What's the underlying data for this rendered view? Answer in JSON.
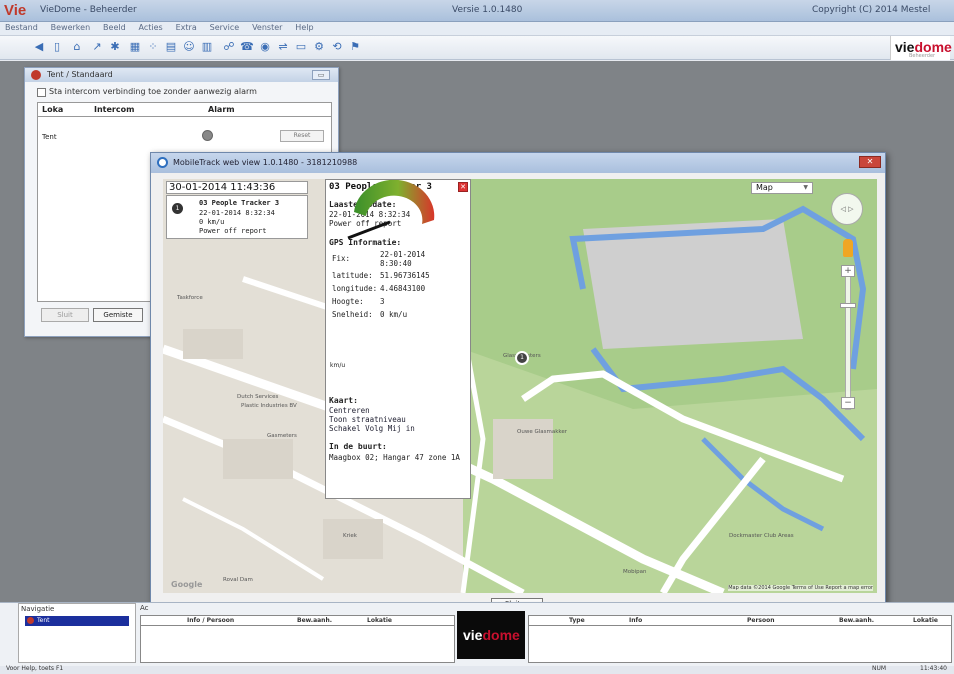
{
  "app": {
    "logo": "Vie",
    "title": "VieDome - Beheerder",
    "version": "Versie 1.0.1480",
    "copyright": "Copyright (C) 2014 Mestel"
  },
  "menu": [
    "Bestand",
    "Bewerken",
    "Beeld",
    "Acties",
    "Extra",
    "Service",
    "Venster",
    "Help"
  ],
  "brand": {
    "logo_part1": "vie",
    "logo_part2": "dome",
    "tagline": "Beheerder"
  },
  "tent_window": {
    "title": "Tent / Standaard",
    "checkbox_label": "Sta intercom verbinding toe zonder aanwezig alarm",
    "columns": [
      "Loka",
      "Intercom",
      "Alarm"
    ],
    "row_name": "Tent",
    "row_button": "Reset",
    "close_button": "Sluit",
    "missed_button": "Gemiste"
  },
  "map_window": {
    "title": "MobileTrack web view 1.0.1480 - 3181210988",
    "close_label": "Sluiten",
    "datetime": "30-01-2014 11:43:36",
    "tracker_list": {
      "number": "1",
      "name": "03 People Tracker 3",
      "date": "22-01-2014 8:32:34",
      "speed": "0 km/u",
      "report": "Power off report"
    },
    "info": {
      "title": "03 People Tracker 3",
      "last_update_label": "Laaste update:",
      "last_update_value": "22-01-2014 8:32:34",
      "last_update_report": "Power off report",
      "gps_label": "GPS Informatie:",
      "fix_label": "Fix:",
      "fix_date": "22-01-2014",
      "fix_time": "8:30:40",
      "latitude_label": "latitude:",
      "latitude_value": "51.96736145",
      "longitude_label": "longitude:",
      "longitude_value": "4.46843100",
      "height_label": "Hoogte:",
      "height_value": "3",
      "speed_label": "Snelheid:",
      "speed_value": "0 km/u",
      "gauge_unit": "km/u",
      "map_label": "Kaart:",
      "map_actions": [
        "Centreren",
        "Toon straatniveau",
        "Schakel Volg Mij in"
      ],
      "nearby_label": "In de buurt:",
      "nearby_value": "Maagbox 02; Hangar 47 zone 1A"
    },
    "map_type": "Map",
    "attribution": "Map data ©2014 Google   Terms of Use   Report a map error",
    "google_logo": "Google",
    "marker_number": "1",
    "labels": [
      "Taskforce",
      "Dutch Services",
      "Plastic Industries BV",
      "Gasmeters",
      "Glasmeesters",
      "Kriek",
      "Dockmaster Club Areas",
      "Ouwe Glasmakker",
      "Mobipan",
      "Roval Dam"
    ]
  },
  "bottom": {
    "nav_label": "Navigatie",
    "nav_item": "Tent",
    "activity_label": "Ac",
    "left_table_headers": [
      "Info / Persoon",
      "Bew.aanh.",
      "Lokatie"
    ],
    "right_table_headers": [
      "Type",
      "Info",
      "Persoon",
      "Bew.aanh.",
      "Lokatie"
    ]
  },
  "status": {
    "help": "Voor Help, toets F1",
    "num": "NUM",
    "time": "11:43:40"
  }
}
